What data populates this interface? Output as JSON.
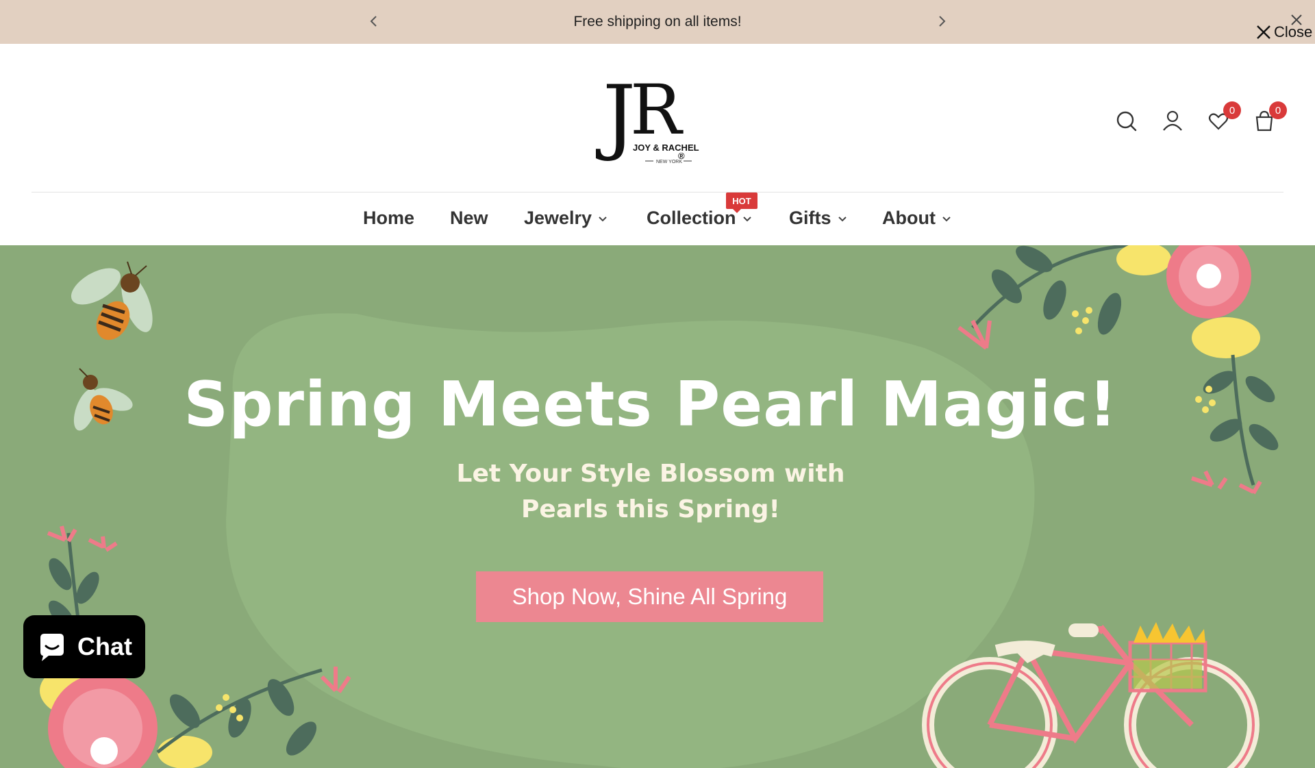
{
  "announcement": {
    "message": "Free shipping on all items!",
    "close_label": "Close"
  },
  "logo": {
    "monogram": "JR",
    "brand": "JOY & RACHEL",
    "city": "NEW YORK"
  },
  "header": {
    "wishlist_count": "0",
    "cart_count": "0"
  },
  "nav": {
    "items": [
      {
        "label": "Home"
      },
      {
        "label": "New"
      },
      {
        "label": "Jewelry"
      },
      {
        "label": "Collection"
      },
      {
        "label": "Gifts"
      },
      {
        "label": "About"
      }
    ],
    "hot_badge": "HOT"
  },
  "hero": {
    "title": "Spring Meets Pearl Magic!",
    "subtitle_line1": "Let Your Style Blossom with",
    "subtitle_line2": "Pearls this Spring!",
    "cta": "Shop Now, Shine All Spring"
  },
  "chat": {
    "label": "Chat"
  },
  "colors": {
    "announcement_bg": "#e2d0c1",
    "hero_bg": "#8aaa79",
    "cta_bg": "#ec8791",
    "badge": "#d93a3a"
  }
}
